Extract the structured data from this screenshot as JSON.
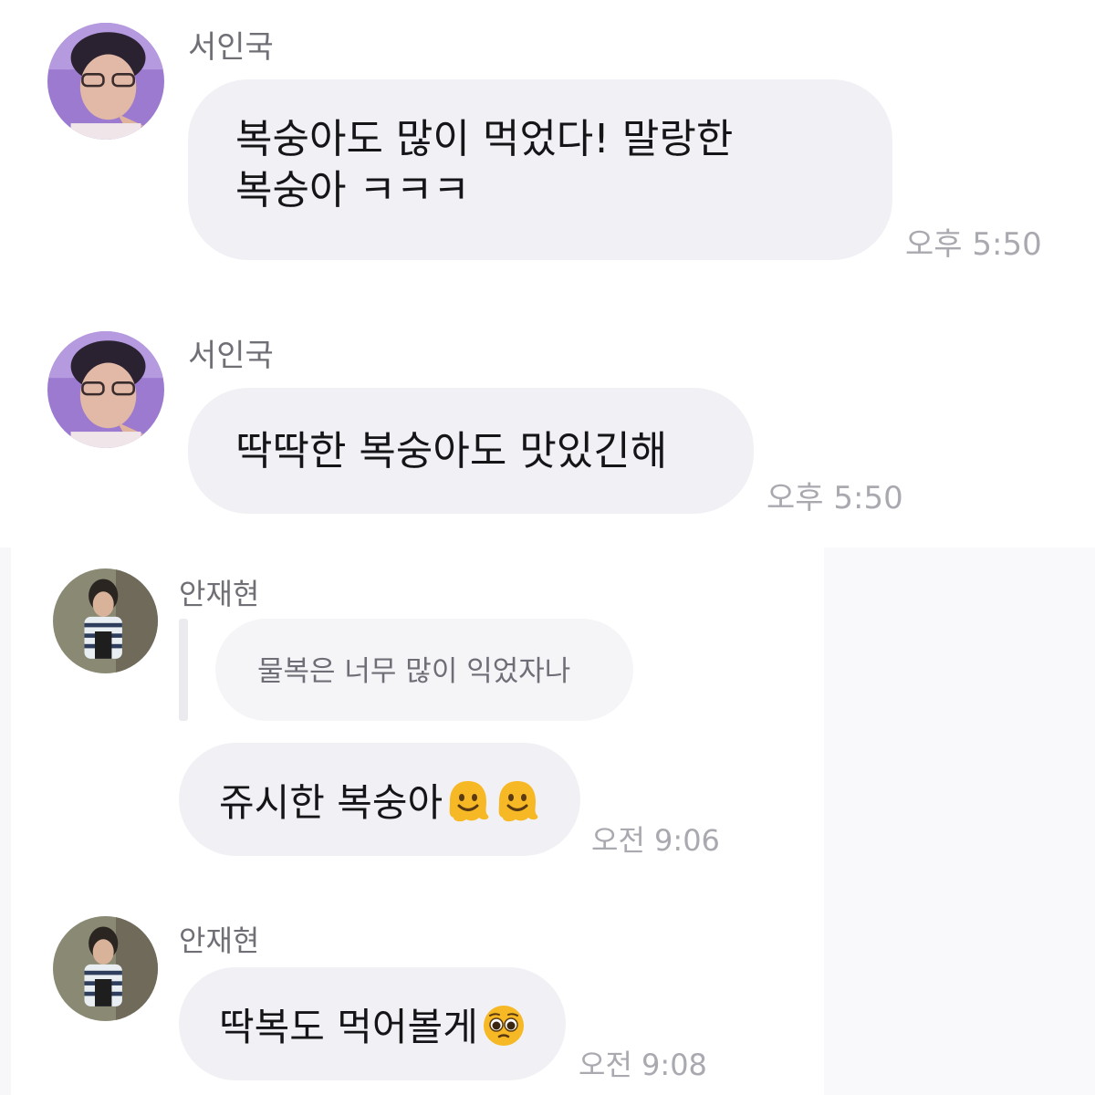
{
  "messages": [
    {
      "sender": "서인국",
      "text": "복숭아도 많이 먹었다! 말랑한\n복숭아 ㅋㅋㅋ",
      "time": "오후 5:50"
    },
    {
      "sender": "서인국",
      "text": "딱딱한 복숭아도 맛있긴해",
      "time": "오후 5:50"
    },
    {
      "sender": "안재현",
      "reply_quote": "물복은 너무 많이 익었자나",
      "text": "쥬시한 복숭아",
      "emojis": [
        "melting-face-emoji",
        "melting-face-emoji"
      ],
      "time": "오전 9:06"
    },
    {
      "sender": "안재현",
      "text": "딱복도 먹어볼게",
      "emojis": [
        "pleading-face-emoji"
      ],
      "time": "오전 9:08"
    }
  ],
  "colors": {
    "bubble": "#f1f1f5",
    "name": "#6f6f76",
    "time": "#a9a9b0",
    "avatar_a": "#9b7ad0",
    "avatar_b": "#8a8a74"
  }
}
